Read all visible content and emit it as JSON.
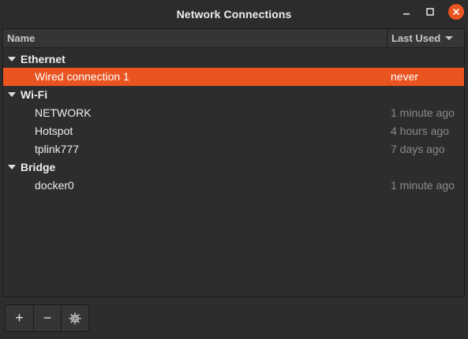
{
  "window": {
    "title": "Network Connections"
  },
  "columns": {
    "name": "Name",
    "last_used": "Last Used"
  },
  "groups": [
    {
      "label": "Ethernet",
      "items": [
        {
          "name": "Wired connection 1",
          "last_used": "never",
          "selected": true
        }
      ]
    },
    {
      "label": "Wi-Fi",
      "items": [
        {
          "name": "NETWORK",
          "last_used": "1 minute ago"
        },
        {
          "name": "Hotspot",
          "last_used": "4 hours ago"
        },
        {
          "name": "tplink777",
          "last_used": "7 days ago"
        }
      ]
    },
    {
      "label": "Bridge",
      "items": [
        {
          "name": "docker0",
          "last_used": "1 minute ago"
        }
      ]
    }
  ],
  "toolbar": {
    "add_icon": "plus-icon",
    "remove_icon": "minus-icon",
    "settings_icon": "gear-icon",
    "add_label": "+",
    "remove_label": "−"
  },
  "colors": {
    "accent": "#e95420",
    "background": "#2d2d2d",
    "muted_text": "#8b8b8b"
  }
}
